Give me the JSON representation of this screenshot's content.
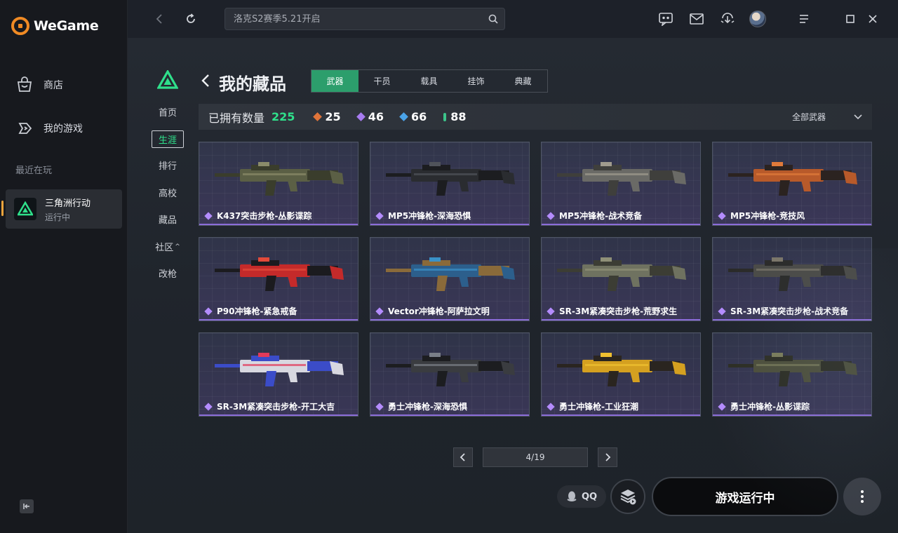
{
  "app": {
    "name": "WeGame"
  },
  "sidebar": {
    "nav": [
      {
        "label": "商店",
        "icon": "shopping-bag-icon"
      },
      {
        "label": "我的游戏",
        "icon": "gamepad-icon"
      }
    ],
    "recent_label": "最近在玩",
    "recent_game": {
      "name": "三角洲行动",
      "status": "运行中"
    }
  },
  "topbar": {
    "search_placeholder": "洛克S2赛季5.21开启",
    "icons": [
      "back-icon",
      "refresh-icon",
      "chat-icon",
      "mail-icon",
      "download-icon",
      "avatar",
      "menu-icon",
      "maximize-icon",
      "close-icon"
    ]
  },
  "page": {
    "side_menu": [
      "首页",
      "生涯",
      "排行",
      "高校",
      "藏品",
      "社区",
      "改枪"
    ],
    "side_menu_active": "生涯",
    "title": "我的藏品",
    "tabs": [
      "武器",
      "干员",
      "载具",
      "挂饰",
      "典藏"
    ],
    "active_tab": "武器",
    "stats": {
      "label": "已拥有数量",
      "total": "225",
      "rarities": [
        {
          "count": "25",
          "color": "#e0743a"
        },
        {
          "count": "46",
          "color": "#a77cf0"
        },
        {
          "count": "66",
          "color": "#4aa3e8"
        },
        {
          "count": "88",
          "color": "#3cc48a"
        }
      ]
    },
    "filter_label": "全部武器",
    "items": [
      {
        "name": "K437突击步枪-丛影谍踪",
        "palette": [
          "#5b5f45",
          "#3a3d2c",
          "#8a8b6a"
        ]
      },
      {
        "name": "MP5冲锋枪-深海恐惧",
        "palette": [
          "#2a2c30",
          "#1c1d20",
          "#50535a"
        ]
      },
      {
        "name": "MP5冲锋枪-战术竞备",
        "palette": [
          "#6a6a66",
          "#3f3f3c",
          "#a09b8e"
        ]
      },
      {
        "name": "MP5冲锋枪-竞技风",
        "palette": [
          "#b85a2a",
          "#2b2320",
          "#e07a3a"
        ]
      },
      {
        "name": "P90冲锋枪-紧急戒备",
        "palette": [
          "#c42a2a",
          "#1b1b1f",
          "#e24a3a"
        ]
      },
      {
        "name": "Vector冲锋枪-阿萨拉文明",
        "palette": [
          "#2c5f8c",
          "#8a6a3a",
          "#3a92c8"
        ]
      },
      {
        "name": "SR-3M紧凑突击步枪-荒野求生",
        "palette": [
          "#6f7260",
          "#3c3d34",
          "#8f9078"
        ]
      },
      {
        "name": "SR-3M紧凑突击步枪-战术竞备",
        "palette": [
          "#4a4a46",
          "#2a2a28",
          "#7b7669"
        ]
      },
      {
        "name": "SR-3M紧凑突击步枪-开工大吉",
        "palette": [
          "#d8d8e0",
          "#3b4cc8",
          "#e23a5a"
        ]
      },
      {
        "name": "勇士冲锋枪-深海恐惧",
        "palette": [
          "#3a3c40",
          "#1c1d20",
          "#7a7f88"
        ]
      },
      {
        "name": "勇士冲锋枪-工业狂潮",
        "palette": [
          "#d4a020",
          "#2a2520",
          "#f0c030"
        ]
      },
      {
        "name": "勇士冲锋枪-丛影谍踪",
        "palette": [
          "#4c4e3a",
          "#2c2d23",
          "#7a7c5a"
        ]
      }
    ],
    "pager": {
      "text": "4/19"
    }
  },
  "actions": {
    "qq_label": "QQ",
    "run_label": "游戏运行中"
  }
}
